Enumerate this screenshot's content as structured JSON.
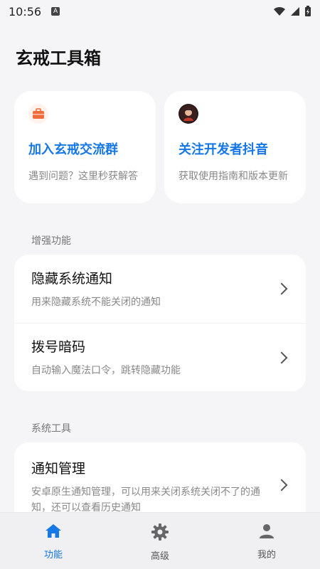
{
  "status_bar": {
    "time": "10:56",
    "notif_letter": "A"
  },
  "page_title": "玄戒工具箱",
  "top_cards": [
    {
      "title": "加入玄戒交流群",
      "desc": "遇到问题？这里秒获解答",
      "icon": "briefcase-icon"
    },
    {
      "title": "关注开发者抖音",
      "desc": "获取使用指南和版本更新",
      "icon": "avatar-icon"
    }
  ],
  "sections": [
    {
      "label": "增强功能",
      "items": [
        {
          "title": "隐藏系统通知",
          "desc": "用来隐藏系统不能关闭的通知"
        },
        {
          "title": "拨号暗码",
          "desc": "自动输入魔法口令，跳转隐藏功能"
        }
      ]
    },
    {
      "label": "系统工具",
      "items": [
        {
          "title": "通知管理",
          "desc": "安卓原生通知管理，可以用来关闭系统关闭不了的通知，还可以查看历史通知"
        }
      ]
    }
  ],
  "bottom_nav": [
    {
      "label": "功能",
      "icon": "home-icon",
      "active": true
    },
    {
      "label": "高级",
      "icon": "gear-icon",
      "active": false
    },
    {
      "label": "我的",
      "icon": "person-icon",
      "active": false
    }
  ],
  "colors": {
    "accent": "#1677e6",
    "background": "#f5f5f7",
    "card": "#ffffff"
  }
}
